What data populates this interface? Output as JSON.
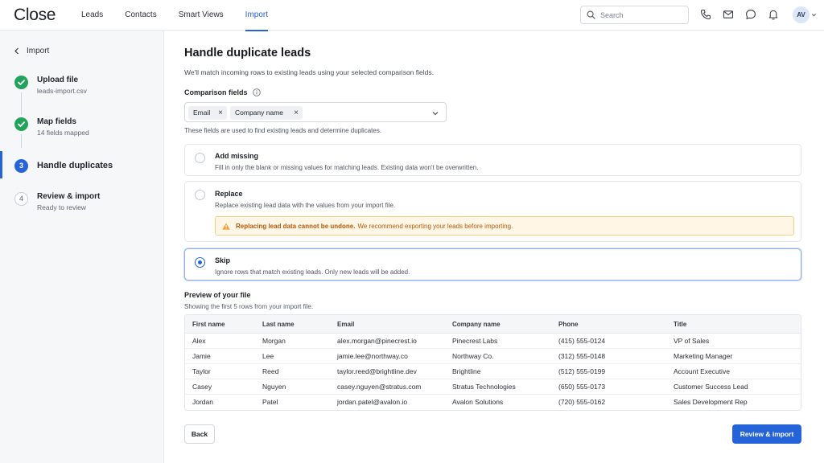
{
  "app": {
    "logo": "Close"
  },
  "nav": {
    "items": [
      {
        "label": "Leads"
      },
      {
        "label": "Contacts"
      },
      {
        "label": "Smart Views"
      },
      {
        "label": "Import"
      }
    ]
  },
  "header": {
    "search_placeholder": "Search",
    "avatar_initials": "AV"
  },
  "sidebar": {
    "back_label": "Import",
    "steps": [
      {
        "title": "Upload file",
        "subtitle": "leads-import.csv",
        "status": "done"
      },
      {
        "title": "Map fields",
        "subtitle": "14 fields mapped",
        "status": "done"
      },
      {
        "number": "3",
        "title": "Handle duplicates",
        "status": "current"
      },
      {
        "number": "4",
        "title": "Review & import",
        "subtitle": "Ready to review",
        "status": "todo"
      }
    ]
  },
  "main": {
    "title": "Handle duplicate leads",
    "subtitle": "We'll match incoming rows to existing leads using your selected comparison fields.",
    "comparison": {
      "label": "Comparison fields",
      "chips": [
        "Email",
        "Company name"
      ],
      "help": "These fields are used to find existing leads and determine duplicates."
    },
    "options": [
      {
        "title": "Add missing",
        "description": "Fill in only the blank or missing values for matching leads. Existing data won't be overwritten.",
        "selected": false
      },
      {
        "title": "Replace",
        "description": "Replace existing lead data with the values from your import file.",
        "selected": false,
        "warning_strong": "Replacing lead data cannot be undone.",
        "warning_rest": "We recommend exporting your leads before importing."
      },
      {
        "title": "Skip",
        "description": "Ignore rows that match existing leads. Only new leads will be added.",
        "selected": true
      }
    ],
    "preview": {
      "title": "Preview of your file",
      "subtitle": "Showing the first 5 rows from your import file.",
      "columns": [
        "First name",
        "Last name",
        "Email",
        "Company name",
        "Phone",
        "Title"
      ],
      "rows": [
        [
          "Alex",
          "Morgan",
          "alex.morgan@pinecrest.io",
          "Pinecrest Labs",
          "(415) 555-0124",
          "VP of Sales"
        ],
        [
          "Jamie",
          "Lee",
          "jamie.lee@northway.co",
          "Northway Co.",
          "(312) 555-0148",
          "Marketing Manager"
        ],
        [
          "Taylor",
          "Reed",
          "taylor.reed@brightline.dev",
          "Brightline",
          "(512) 555-0199",
          "Account Executive"
        ],
        [
          "Casey",
          "Nguyen",
          "casey.nguyen@stratus.com",
          "Stratus Technologies",
          "(650) 555-0173",
          "Customer Success Lead"
        ],
        [
          "Jordan",
          "Patel",
          "jordan.patel@avalon.io",
          "Avalon Solutions",
          "(720) 555-0162",
          "Sales Development Rep"
        ]
      ]
    },
    "back_button": "Back",
    "primary_button": "Review & import"
  },
  "colors": {
    "accent": "#2563d9",
    "success": "#21a35b",
    "warning_bg": "#fff6e5",
    "warning_text": "#b45a0c"
  },
  "icons": {
    "search": "search-icon",
    "phone": "phone-icon",
    "mail": "mail-icon",
    "chat": "chat-icon",
    "notifications": "bell-icon",
    "back": "chevron-left-icon",
    "check": "check-icon",
    "info": "info-icon",
    "dropdown": "chevron-down-icon",
    "warning": "warning-icon",
    "remove": "close-icon"
  }
}
